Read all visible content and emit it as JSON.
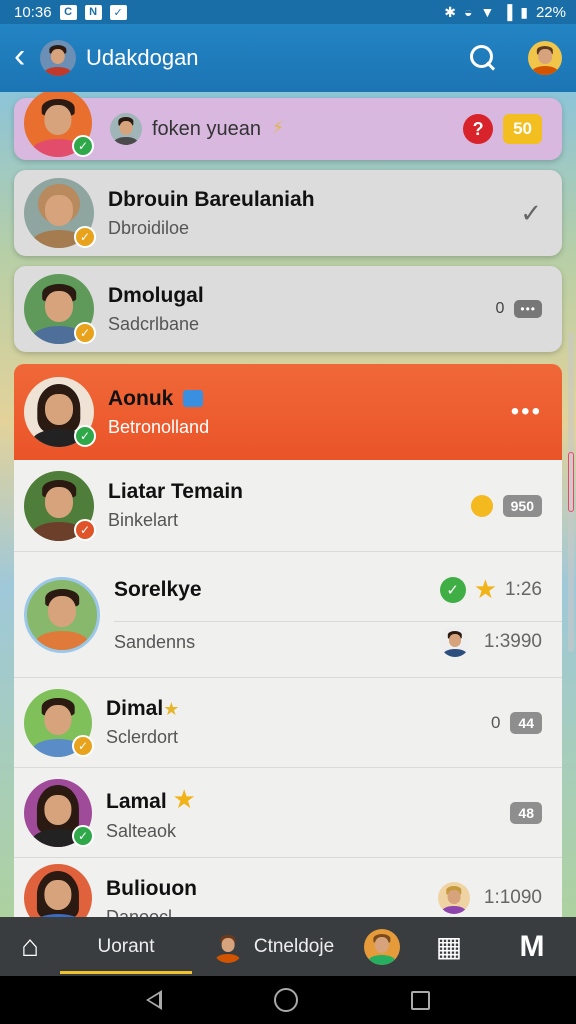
{
  "status_bar": {
    "time": "10:36",
    "battery": "22%"
  },
  "app_bar": {
    "title": "Udakdogan"
  },
  "pinned": {
    "title": "foken yuean",
    "alert": "?",
    "count": "50"
  },
  "contacts_top": [
    {
      "name": "Dbrouin Bareulaniah",
      "sub": "Dbroidiloe"
    },
    {
      "name": "Dmolugal",
      "sub": "Sadcrlbane",
      "right_num": "0"
    }
  ],
  "highlighted": {
    "name": "Aonuk",
    "sub": "Betronolland"
  },
  "contacts": [
    {
      "name": "Liatar Temain",
      "sub": "Binkelart",
      "pill": "950"
    },
    {
      "name": "Sorelkye",
      "sub": "Sandenns",
      "time": "1:26",
      "time2": "1:3990"
    },
    {
      "name": "Dimal",
      "sub": "Sclerdort",
      "right_num": "0",
      "pill": "44"
    },
    {
      "name": "Lamal",
      "sub": "Salteaok",
      "pill": "48"
    },
    {
      "name": "Buliouon",
      "sub": "Danoocl",
      "time": "1:1090"
    }
  ],
  "bottom_nav": {
    "tab1": "Uorant",
    "tab2": "Ctneldoje"
  },
  "colors": {
    "app_bar": "#1c74b3",
    "highlight": "#ef5a2f",
    "pinned_bg": "#d9b8e0",
    "accent": "#f0c22b"
  }
}
